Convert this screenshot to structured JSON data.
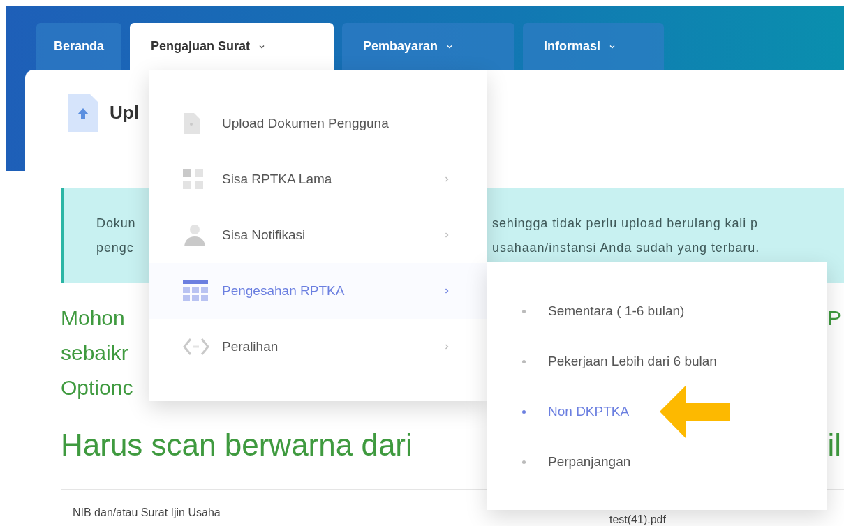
{
  "nav_tabs": [
    {
      "label": "Beranda",
      "selected": false,
      "has_dropdown": false
    },
    {
      "label": "Pengajuan Surat",
      "selected": true,
      "has_dropdown": true
    },
    {
      "label": "Pembayaran",
      "selected": false,
      "has_dropdown": true
    },
    {
      "label": "Informasi",
      "selected": false,
      "has_dropdown": true
    }
  ],
  "page": {
    "title": "Upl",
    "notice_lines": [
      {
        "left": "Dokun",
        "right": "sehingga tidak perlu upload berulang kali p"
      },
      {
        "left": "pengc",
        "right": "usahaan/instansi Anda sudah yang terbaru."
      }
    ],
    "instruction_lines": [
      {
        "left": "Mohon",
        "right": "P"
      },
      {
        "left": "sebaikr"
      },
      {
        "left": "Optionc"
      }
    ],
    "heading": {
      "left": "Harus scan berwarna dari",
      "right": "il"
    },
    "document_row": {
      "label": "NIB dan/atau Surat Ijin Usaha",
      "file": "test(41).pdf"
    }
  },
  "dropdown_menu": {
    "items": [
      {
        "label": "Upload Dokumen Pengguna",
        "kind": "document",
        "has_submenu": false,
        "selected": false
      },
      {
        "label": "Sisa RPTKA Lama",
        "kind": "grid",
        "has_submenu": true,
        "selected": false
      },
      {
        "label": "Sisa Notifikasi",
        "kind": "person",
        "has_submenu": true,
        "selected": false
      },
      {
        "label": "Pengesahan RPTKA",
        "kind": "table",
        "has_submenu": true,
        "selected": true
      },
      {
        "label": "Peralihan",
        "kind": "code",
        "has_submenu": true,
        "selected": false
      }
    ]
  },
  "submenu": {
    "items": [
      {
        "label": "Sementara ( 1-6 bulan)",
        "selected": false
      },
      {
        "label": "Pekerjaan Lebih dari 6 bulan",
        "selected": false
      },
      {
        "label": "Non DKPTKA",
        "selected": true
      },
      {
        "label": "Perpanjangan",
        "selected": false
      }
    ]
  }
}
